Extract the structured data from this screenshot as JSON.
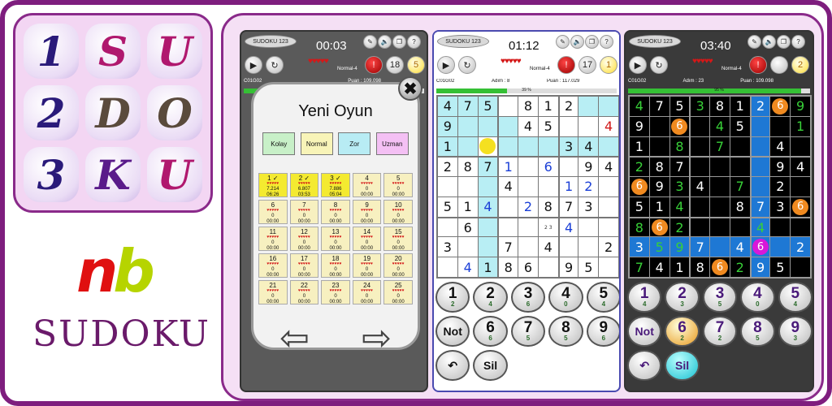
{
  "logo_tiles": [
    "1",
    "S",
    "U",
    "2",
    "D",
    "O",
    "3",
    "K",
    "U"
  ],
  "brand": {
    "mark_n": "n",
    "mark_b": "b",
    "name": "SUDOKU"
  },
  "colors": {
    "border": "#7e1e7e",
    "panel_bg": "#f5e0f5",
    "highlight": "#b8eef4",
    "progress": "#35c035"
  },
  "phones": [
    {
      "app_title": "SUDOKU 123",
      "timer": "00:03",
      "hearts": "♥♥♥♥♥",
      "level": "Normal-4",
      "code": "C01G02",
      "lv": "Lv-8",
      "adim": "",
      "puan": "Puan : 109.098",
      "progress_label": "95 %",
      "progress": 0.95,
      "hint_count": "18",
      "bulb_count": "5"
    },
    {
      "app_title": "SUDOKU 123",
      "timer": "01:12",
      "hearts": "♥♥♥♥♥",
      "level": "Normal-4",
      "code": "C01G02",
      "lv": "Lv-9",
      "adim": "Adım : 8",
      "puan": "Puan : 117.029",
      "progress_label": "39 %",
      "progress": 0.39,
      "hint_count": "17",
      "bulb_count": "1"
    },
    {
      "app_title": "SUDOKU 123",
      "timer": "03:40",
      "hearts": "♥♥♥♥♥",
      "level": "Normal-4",
      "code": "C01G02",
      "lv": "Lv-8",
      "adim": "Adım : 23",
      "puan": "Puan : 109.098",
      "progress_label": "95 %",
      "progress": 0.95,
      "hint_count": "",
      "bulb_count": "2"
    }
  ],
  "new_game": {
    "title": "Yeni Oyun",
    "difficulties": [
      {
        "label": "Kolay",
        "color": "#c8f0c8"
      },
      {
        "label": "Normal",
        "color": "#f8f4b8"
      },
      {
        "label": "Zor",
        "color": "#b8ecf4"
      },
      {
        "label": "Uzman",
        "color": "#f4c0f4"
      }
    ],
    "close": "✖",
    "levels": [
      {
        "n": "1 ✓",
        "s": "7.214",
        "t": "06:26",
        "done": true
      },
      {
        "n": "2 ✓",
        "s": "6.807",
        "t": "03:53",
        "done": true
      },
      {
        "n": "3 ✓",
        "s": "7.886",
        "t": "05:04",
        "done": true
      },
      {
        "n": "4",
        "s": "0",
        "t": "00:00"
      },
      {
        "n": "5",
        "s": "0",
        "t": "00:00"
      },
      {
        "n": "6",
        "s": "0",
        "t": "00:00"
      },
      {
        "n": "7",
        "s": "0",
        "t": "00:00"
      },
      {
        "n": "8",
        "s": "0",
        "t": "00:00"
      },
      {
        "n": "9",
        "s": "0",
        "t": "00:00"
      },
      {
        "n": "10",
        "s": "0",
        "t": "00:00"
      },
      {
        "n": "11",
        "s": "0",
        "t": "00:00"
      },
      {
        "n": "12",
        "s": "0",
        "t": "00:00"
      },
      {
        "n": "13",
        "s": "0",
        "t": "00:00"
      },
      {
        "n": "14",
        "s": "0",
        "t": "00:00"
      },
      {
        "n": "15",
        "s": "0",
        "t": "00:00"
      },
      {
        "n": "16",
        "s": "0",
        "t": "00:00"
      },
      {
        "n": "17",
        "s": "0",
        "t": "00:00"
      },
      {
        "n": "18",
        "s": "0",
        "t": "00:00"
      },
      {
        "n": "19",
        "s": "0",
        "t": "00:00"
      },
      {
        "n": "20",
        "s": "0",
        "t": "00:00"
      },
      {
        "n": "21",
        "s": "0",
        "t": "00:00"
      },
      {
        "n": "22",
        "s": "0",
        "t": "00:00"
      },
      {
        "n": "23",
        "s": "0",
        "t": "00:00"
      },
      {
        "n": "24",
        "s": "0",
        "t": "00:00"
      },
      {
        "n": "25",
        "s": "0",
        "t": "00:00"
      }
    ],
    "arrow_left": "⇦",
    "arrow_right": "⇨"
  },
  "grid2": [
    [
      "4",
      "7",
      "5",
      "",
      "8",
      "1",
      "2",
      "",
      ""
    ],
    [
      "9",
      "",
      "",
      "",
      "4",
      "5",
      "",
      "",
      "4"
    ],
    [
      "1",
      "",
      "●",
      "",
      "",
      "",
      "3",
      "4",
      ""
    ],
    [
      "2",
      "8",
      "7",
      "1",
      "",
      "6",
      "",
      "9",
      "4"
    ],
    [
      "",
      "",
      "",
      "4",
      "",
      "",
      "1",
      "2",
      ""
    ],
    [
      "5",
      "1",
      "4",
      "",
      "2",
      "8",
      "7",
      "3",
      ""
    ],
    [
      "",
      "6",
      "",
      "",
      "",
      "23",
      "4",
      "",
      ""
    ],
    [
      "3",
      "",
      "",
      "7",
      "",
      "4",
      "",
      "",
      "2"
    ],
    [
      "",
      "4",
      "1",
      "8",
      "6",
      "",
      "9",
      "5",
      ""
    ]
  ],
  "grid2_hl": [
    [
      0,
      0
    ],
    [
      0,
      1
    ],
    [
      0,
      2
    ],
    [
      1,
      1
    ],
    [
      1,
      2
    ],
    [
      1,
      3
    ],
    [
      2,
      0
    ],
    [
      2,
      1
    ],
    [
      2,
      3
    ],
    [
      2,
      4
    ],
    [
      2,
      5
    ],
    [
      2,
      6
    ],
    [
      2,
      7
    ],
    [
      2,
      8
    ],
    [
      3,
      2
    ],
    [
      4,
      2
    ],
    [
      5,
      2
    ],
    [
      6,
      2
    ],
    [
      7,
      2
    ],
    [
      8,
      2
    ],
    [
      1,
      0
    ],
    [
      0,
      7
    ],
    [
      0,
      8
    ]
  ],
  "grid2_user": [
    [
      3,
      3
    ],
    [
      3,
      5
    ],
    [
      4,
      6
    ],
    [
      4,
      7
    ],
    [
      5,
      2
    ],
    [
      5,
      4
    ],
    [
      6,
      6
    ],
    [
      8,
      1
    ]
  ],
  "grid2_error": [
    [
      1,
      8
    ]
  ],
  "grid3": [
    [
      "4",
      "7",
      "5",
      "3",
      "8",
      "1",
      "2",
      "6",
      "9"
    ],
    [
      "9",
      "",
      "6",
      "",
      "4",
      "5",
      "",
      "",
      "1"
    ],
    [
      "1",
      "",
      "8",
      "",
      "7",
      "",
      "",
      "4",
      ""
    ],
    [
      "2",
      "8",
      "7",
      "",
      "",
      "",
      "",
      "9",
      "4"
    ],
    [
      "6",
      "9",
      "3",
      "4",
      "",
      "7",
      "",
      "2",
      ""
    ],
    [
      "5",
      "1",
      "4",
      "",
      "",
      "8",
      "7",
      "3",
      "6"
    ],
    [
      "8",
      "6",
      "2",
      "",
      "",
      "",
      "4",
      "",
      ""
    ],
    [
      "3",
      "5",
      "9",
      "7",
      "",
      "4",
      "6",
      "",
      "2"
    ],
    [
      "7",
      "4",
      "1",
      "8",
      "6",
      "2",
      "9",
      "5",
      ""
    ]
  ],
  "grid3_hl": [
    [
      0,
      6
    ],
    [
      1,
      6
    ],
    [
      2,
      6
    ],
    [
      3,
      6
    ],
    [
      4,
      6
    ],
    [
      5,
      6
    ],
    [
      6,
      6
    ],
    [
      7,
      6
    ],
    [
      8,
      6
    ],
    [
      7,
      0
    ],
    [
      7,
      1
    ],
    [
      7,
      2
    ],
    [
      7,
      3
    ],
    [
      7,
      4
    ],
    [
      7,
      5
    ],
    [
      7,
      7
    ],
    [
      7,
      8
    ]
  ],
  "grid3_user": [
    [
      0,
      0
    ],
    [
      0,
      3
    ],
    [
      0,
      8
    ],
    [
      1,
      4
    ],
    [
      1,
      8
    ],
    [
      2,
      2
    ],
    [
      2,
      4
    ],
    [
      3,
      0
    ],
    [
      4,
      2
    ],
    [
      4,
      5
    ],
    [
      5,
      2
    ],
    [
      6,
      0
    ],
    [
      6,
      2
    ],
    [
      6,
      6
    ],
    [
      7,
      1
    ],
    [
      7,
      2
    ],
    [
      8,
      0
    ],
    [
      8,
      5
    ]
  ],
  "grid3_dots": {
    "0,7": "o",
    "1,2": "o",
    "4,0": "o",
    "5,8": "o",
    "6,1": "o",
    "7,6": "m",
    "8,4": "o"
  },
  "numpad2": [
    {
      "n": "1",
      "c": "2"
    },
    {
      "n": "2",
      "c": "4"
    },
    {
      "n": "3",
      "c": "6"
    },
    {
      "n": "4",
      "c": "0"
    },
    {
      "n": "5",
      "c": "4"
    },
    {
      "n": "Not",
      "c": ""
    },
    {
      "n": "6",
      "c": "6"
    },
    {
      "n": "7",
      "c": "5"
    },
    {
      "n": "8",
      "c": "5"
    },
    {
      "n": "9",
      "c": "6"
    },
    {
      "n": "↶",
      "c": ""
    },
    {
      "n": "Sil",
      "c": ""
    }
  ],
  "numpad3": [
    {
      "n": "1",
      "c": "4"
    },
    {
      "n": "2",
      "c": "3"
    },
    {
      "n": "3",
      "c": "5"
    },
    {
      "n": "4",
      "c": "0"
    },
    {
      "n": "5",
      "c": "4"
    },
    {
      "n": "Not",
      "c": ""
    },
    {
      "n": "6",
      "c": "2"
    },
    {
      "n": "7",
      "c": "2"
    },
    {
      "n": "8",
      "c": "5"
    },
    {
      "n": "9",
      "c": "3"
    },
    {
      "n": "↶",
      "c": ""
    },
    {
      "n": "Sil",
      "c": ""
    }
  ]
}
